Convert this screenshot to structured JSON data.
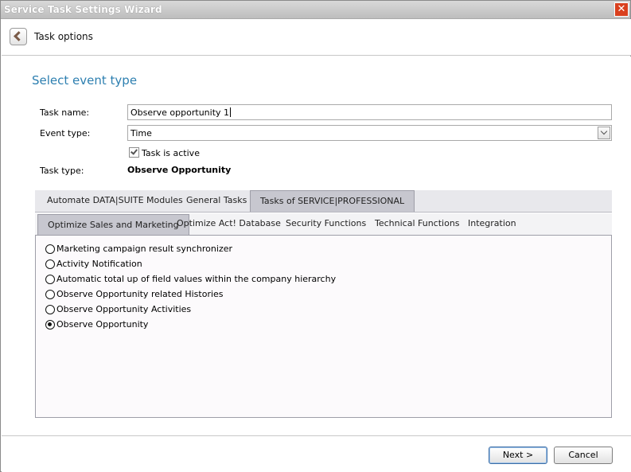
{
  "window": {
    "title": "Service Task Settings Wizard",
    "close_symbol": "✕"
  },
  "header": {
    "back_icon": "chevron-left-icon",
    "title": "Task options"
  },
  "section_title": "Select event type",
  "form": {
    "task_name_label": "Task name:",
    "task_name_value": "Observe opportunity 1",
    "event_type_label": "Event type:",
    "event_type_value": "Time",
    "task_active_label": "Task is active",
    "task_active_checked": true,
    "task_type_label": "Task type:",
    "task_type_value": "Observe Opportunity"
  },
  "outer_tabs": [
    {
      "label": "Automate DATA|SUITE Modules",
      "active": false
    },
    {
      "label": "General Tasks",
      "active": false
    },
    {
      "label": "Tasks of SERVICE|PROFESSIONAL",
      "active": true
    }
  ],
  "inner_tabs": [
    {
      "label": "Optimize Sales and Marketing",
      "active": true
    },
    {
      "label": "Optimize Act! Database",
      "active": false
    },
    {
      "label": "Security Functions",
      "active": false
    },
    {
      "label": "Technical Functions",
      "active": false
    },
    {
      "label": "Integration",
      "active": false
    }
  ],
  "options": [
    {
      "label": "Marketing campaign result synchronizer",
      "selected": false
    },
    {
      "label": "Activity Notification",
      "selected": false
    },
    {
      "label": "Automatic total up of field values within the company hierarchy",
      "selected": false
    },
    {
      "label": "Observe Opportunity related Histories",
      "selected": false
    },
    {
      "label": "Observe Opportunity Activities",
      "selected": false
    },
    {
      "label": "Observe Opportunity",
      "selected": true
    }
  ],
  "footer": {
    "next_label": "Next >",
    "cancel_label": "Cancel"
  },
  "colors": {
    "section_title": "#2d7fb0",
    "close_button": "#d9401e",
    "active_tab": "#c7c7cf"
  }
}
